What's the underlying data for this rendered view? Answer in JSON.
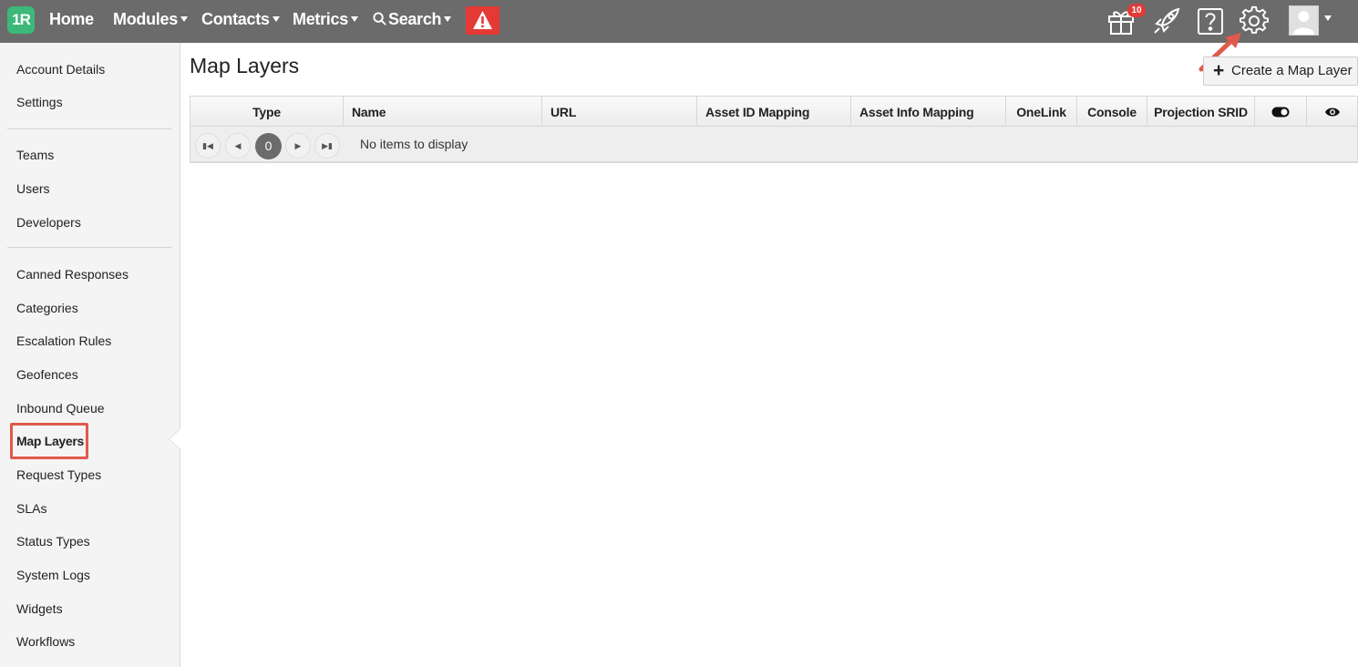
{
  "topbar": {
    "logo_text": "1R",
    "nav": [
      {
        "label": "Home",
        "has_caret": false
      },
      {
        "label": "Modules",
        "has_caret": true
      },
      {
        "label": "Contacts",
        "has_caret": true
      },
      {
        "label": "Metrics",
        "has_caret": true
      },
      {
        "label": "Search",
        "has_caret": true
      }
    ],
    "gift_badge": "10",
    "icons": [
      "search-icon",
      "alert-icon",
      "gift-icon",
      "rocket-icon",
      "help-icon",
      "gear-icon",
      "user-avatar"
    ],
    "colors": {
      "bar": "#6b6b6b",
      "logo": "#3cb878",
      "alert": "#e53935"
    }
  },
  "sidebar": {
    "groups": [
      [
        "Account Details",
        "Settings"
      ],
      [
        "Teams",
        "Users",
        "Developers"
      ],
      [
        "Canned Responses",
        "Categories",
        "Escalation Rules",
        "Geofences",
        "Inbound Queue",
        "Map Layers",
        "Request Types",
        "SLAs",
        "Status Types",
        "System Logs",
        "Widgets",
        "Workflows"
      ]
    ],
    "active": "Map Layers",
    "highlight_color": "#e05a4b"
  },
  "main": {
    "title": "Map Layers",
    "create_button": "Create a Map Layer",
    "columns": [
      "Type",
      "Name",
      "URL",
      "Asset ID Mapping",
      "Asset Info Mapping",
      "OneLink",
      "Console",
      "Projection SRID"
    ],
    "icon_columns": [
      "toggle-icon",
      "eye-icon"
    ],
    "pager": {
      "current_page": "0",
      "message": "No items to display"
    }
  }
}
